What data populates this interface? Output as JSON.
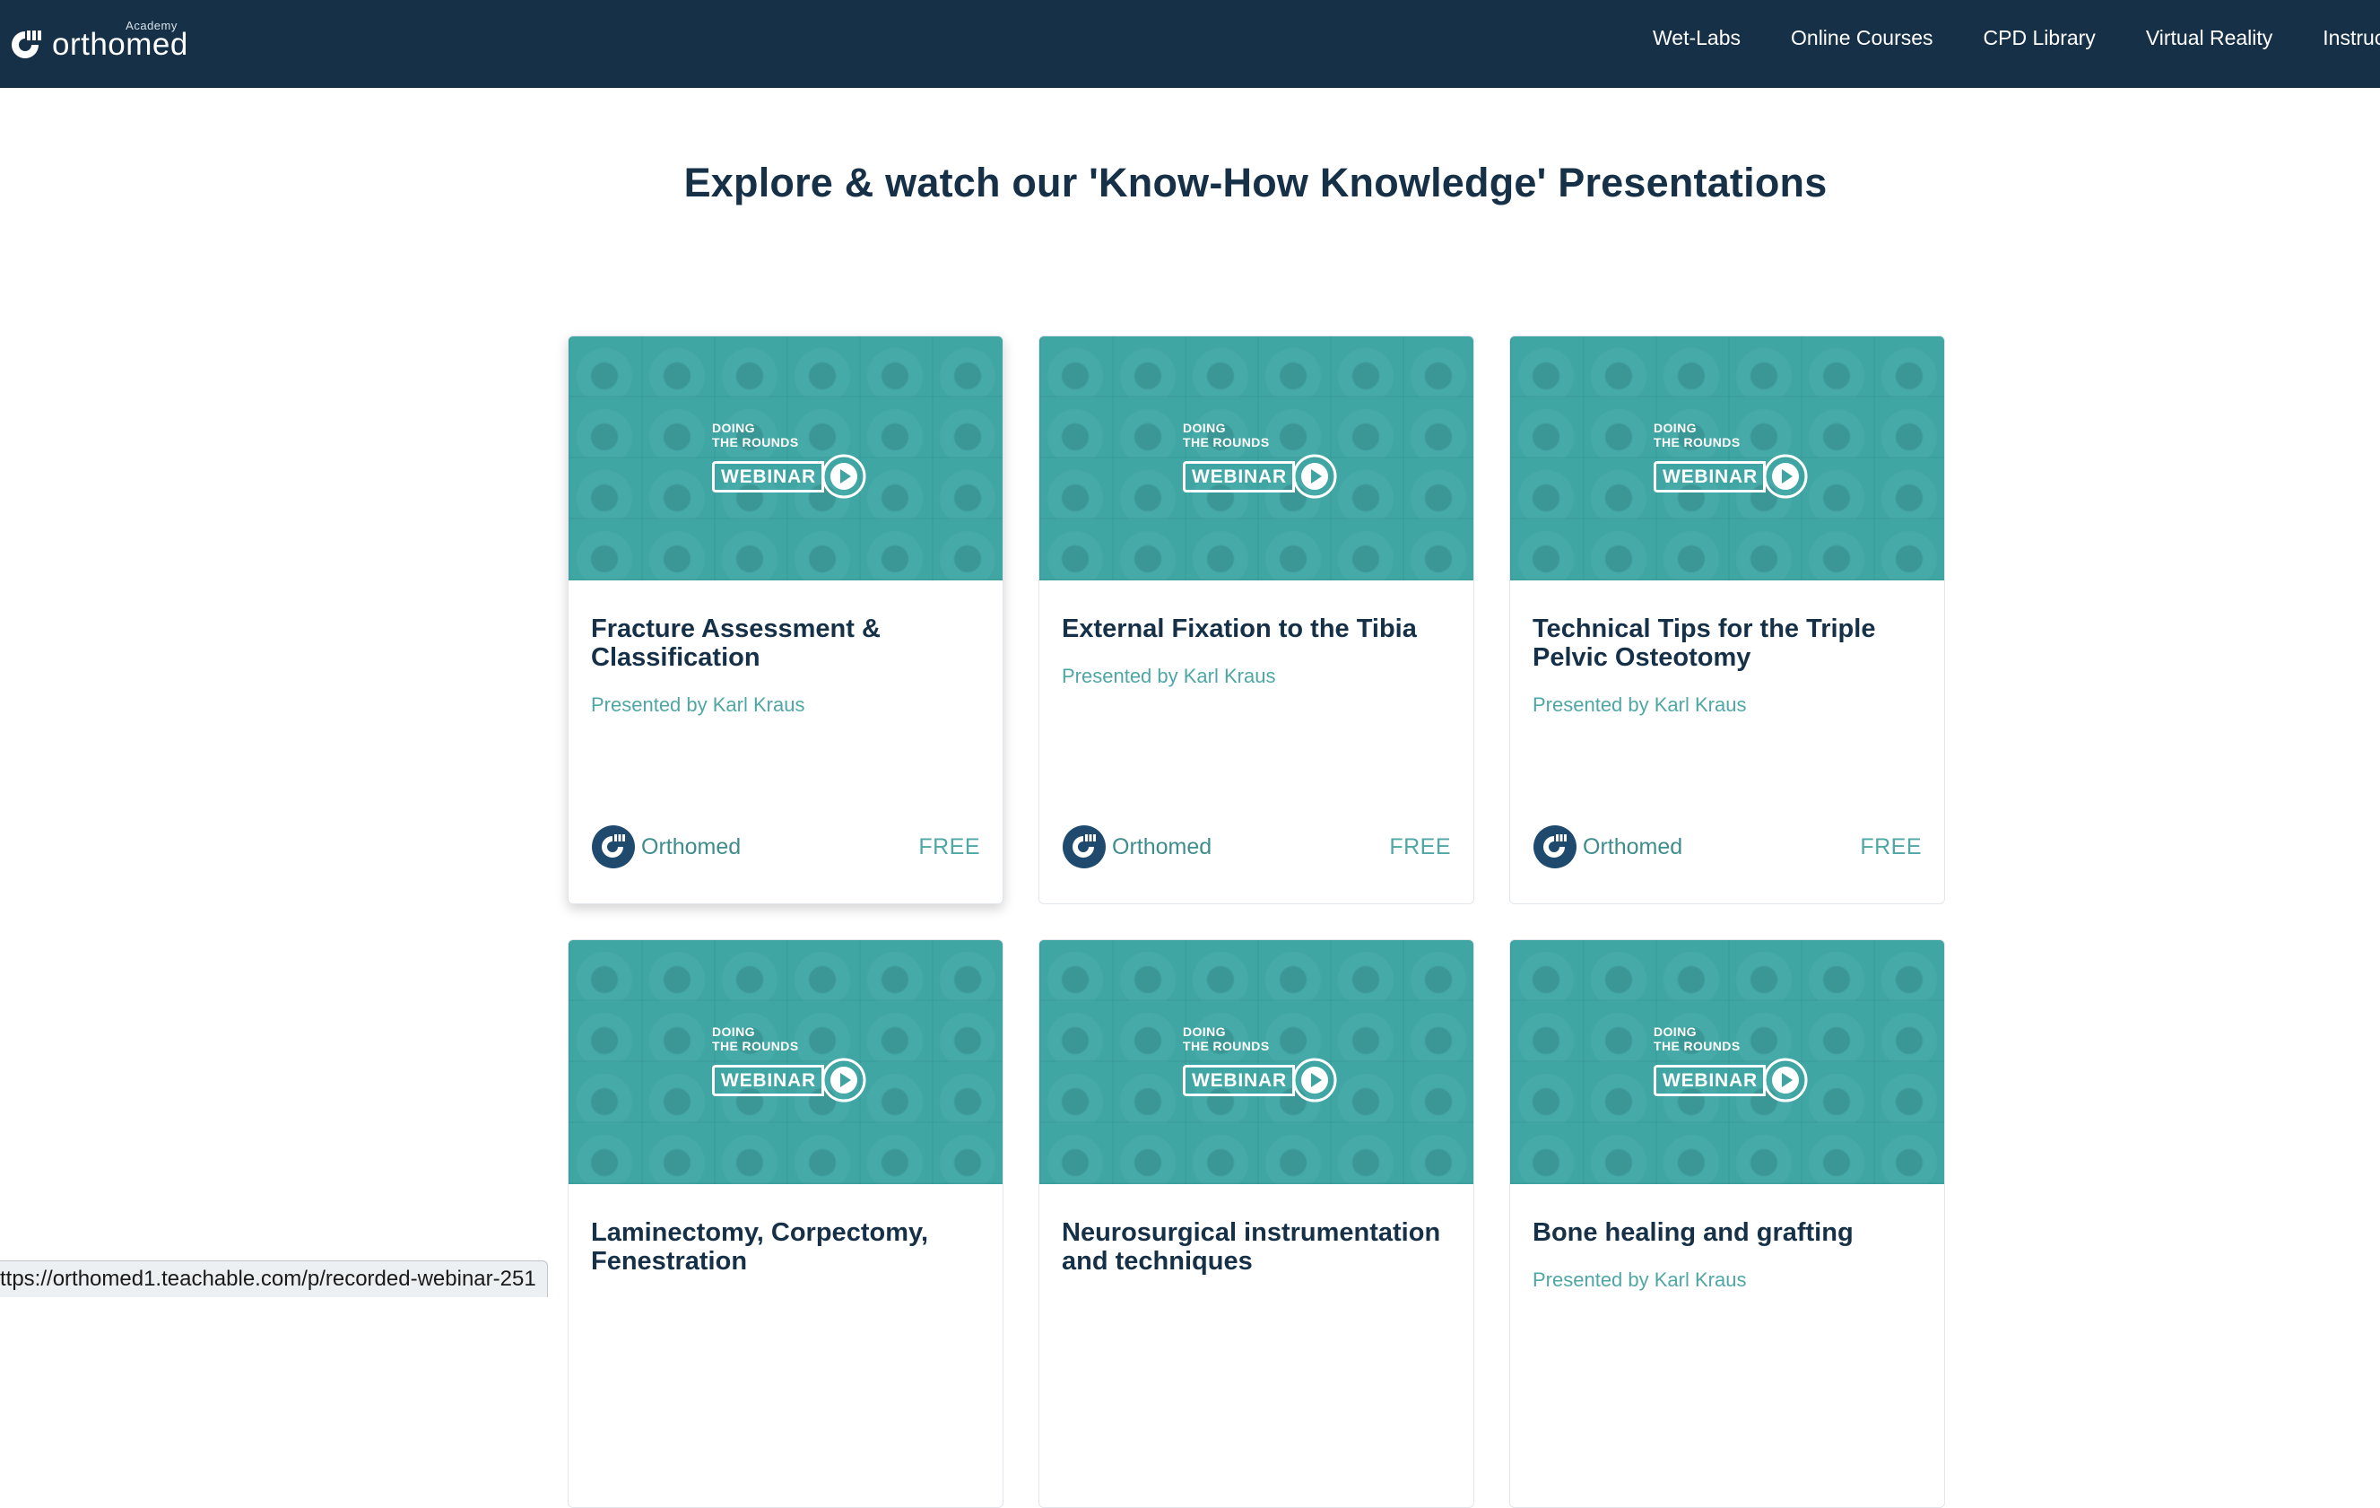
{
  "brand": {
    "name": "orthomed",
    "tag": "Academy",
    "logo_icon": "orthomed-logo-icon",
    "colors": {
      "navy": "#153047",
      "teal": "#4fa7a5",
      "thumb_teal": "#3fa3a2"
    }
  },
  "nav": {
    "items": [
      {
        "label": "Wet-Labs"
      },
      {
        "label": "Online Courses"
      },
      {
        "label": "CPD Library"
      },
      {
        "label": "Virtual Reality"
      },
      {
        "label": "Instructo"
      }
    ]
  },
  "page": {
    "title": "Explore & watch our 'Know-How Knowledge' Presentations"
  },
  "thumbnail": {
    "line1": "DOING",
    "line2": "THE ROUNDS",
    "badge": "WEBINAR",
    "badge_icon": "play-circle-icon"
  },
  "courses": [
    {
      "title": "Fracture Assessment & Classification",
      "author": "Presented by Karl Kraus",
      "provider": "Orthomed",
      "price": "FREE"
    },
    {
      "title": "External Fixation to the Tibia",
      "author": "Presented by Karl Kraus",
      "provider": "Orthomed",
      "price": "FREE"
    },
    {
      "title": "Technical Tips for the Triple Pelvic Osteotomy",
      "author": "Presented by Karl Kraus",
      "provider": "Orthomed",
      "price": "FREE"
    },
    {
      "title": "Laminectomy, Corpectomy, Fenestration",
      "author": "",
      "provider": "",
      "price": ""
    },
    {
      "title": "Neurosurgical instrumentation and techniques",
      "author": "",
      "provider": "",
      "price": ""
    },
    {
      "title": "Bone healing and grafting",
      "author": "Presented by Karl Kraus",
      "provider": "",
      "price": ""
    }
  ],
  "status_bar": {
    "url": "ttps://orthomed1.teachable.com/p/recorded-webinar-251"
  }
}
